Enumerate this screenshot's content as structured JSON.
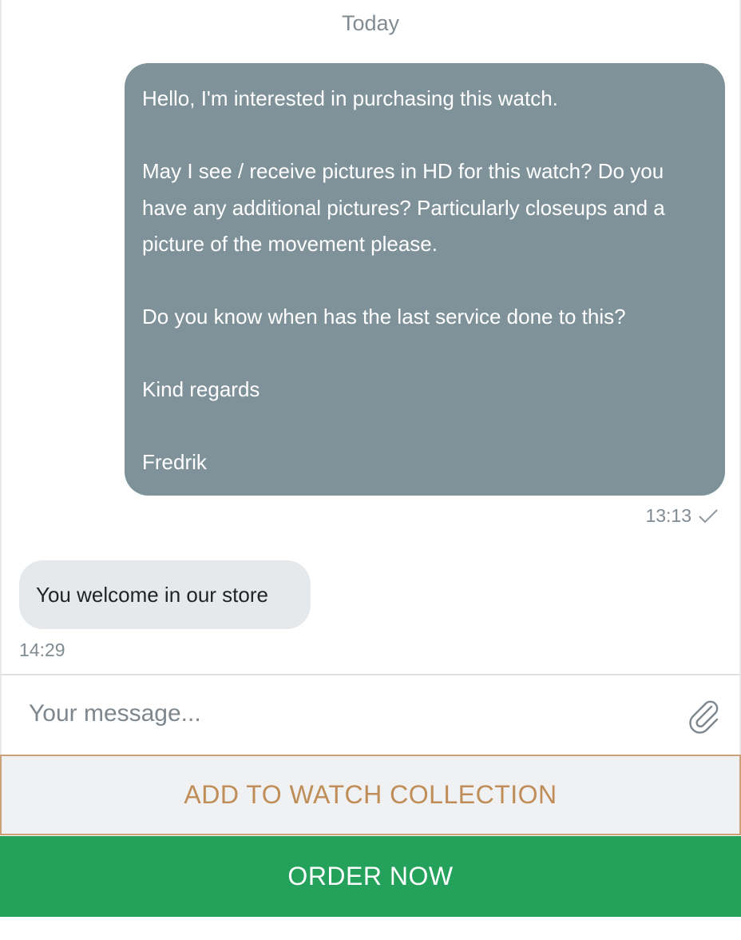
{
  "chat": {
    "date_divider": "Today",
    "outgoing": {
      "paragraphs": [
        "Hello, I'm interested in purchasing this watch.",
        "May I see / receive pictures in HD for this watch? Do you have any additional pictures? Particularly closeups and a picture of the movement please.",
        "Do you know when has the last service done to this?",
        "Kind regards",
        "Fredrik"
      ],
      "time": "13:13",
      "status_icon": "check-icon"
    },
    "incoming": {
      "text": "You welcome in our store",
      "time": "14:29"
    }
  },
  "composer": {
    "placeholder": "Your message...",
    "attach_icon": "paperclip-icon"
  },
  "actions": {
    "add_to_collection_label": "ADD TO WATCH COLLECTION",
    "order_now_label": "ORDER NOW"
  },
  "colors": {
    "outgoing_bubble": "#7f9299",
    "incoming_bubble": "#e6e9ec",
    "accent_gold": "#bf8d57",
    "order_green": "#24a25c"
  }
}
